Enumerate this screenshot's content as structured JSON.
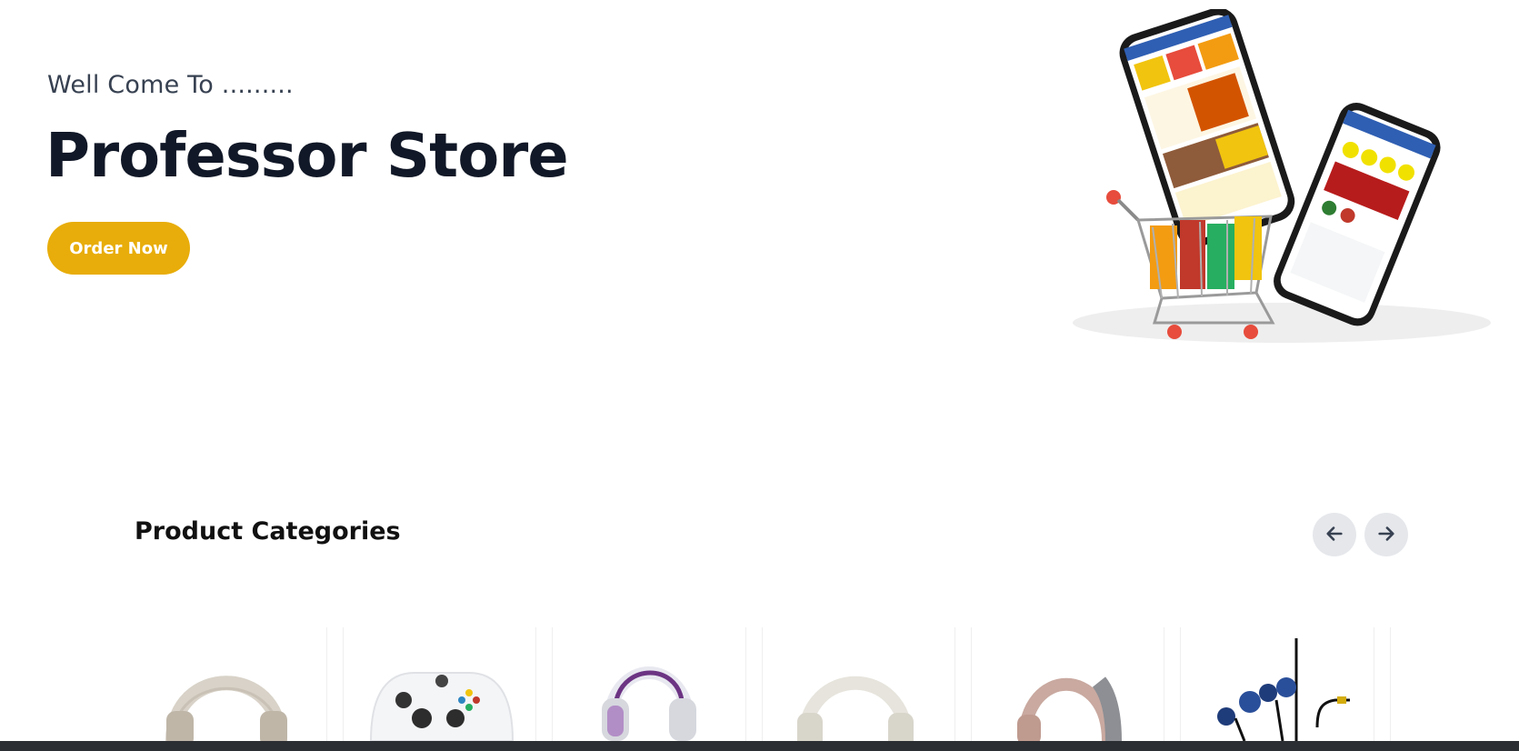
{
  "hero": {
    "subtitle": "Well Come To .........",
    "title": "Professor Store",
    "order_button": "Order Now",
    "image_icon": "shopping-cart-with-phones-illustration"
  },
  "categories": {
    "title": "Product Categories",
    "prev_icon": "arrow-left-icon",
    "next_icon": "arrow-right-icon",
    "items": [
      {
        "icon": "over-ear-headphones-beige"
      },
      {
        "icon": "game-controller-white"
      },
      {
        "icon": "gaming-headset-white"
      },
      {
        "icon": "over-ear-headphones-cream"
      },
      {
        "icon": "headphones-pink-grey"
      },
      {
        "icon": "in-ear-earphones-blue"
      }
    ]
  },
  "colors": {
    "accent": "#e8ad0a",
    "title": "#111827",
    "nav_button_bg": "#e5e7eb"
  }
}
